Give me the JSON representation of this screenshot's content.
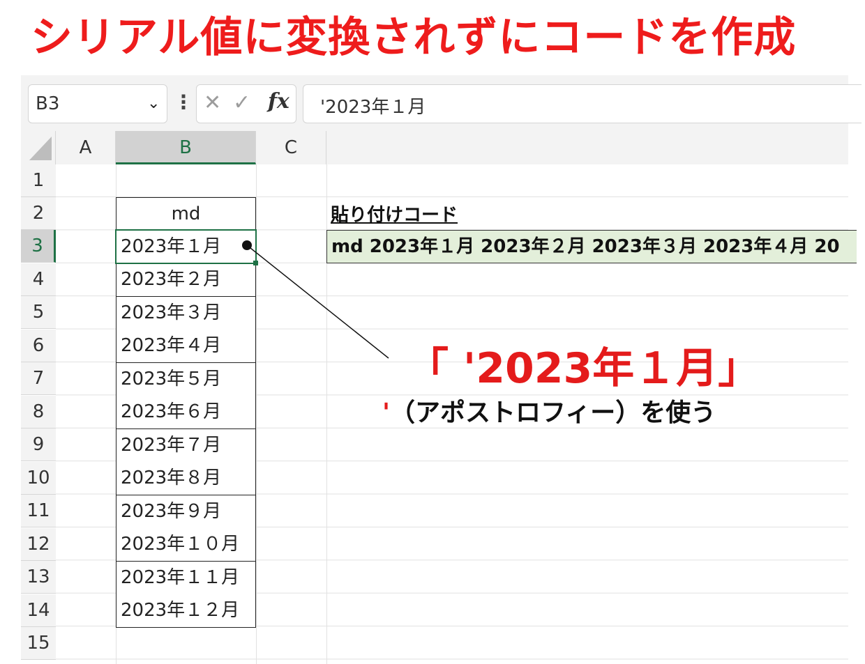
{
  "headline": "シリアル値に変換されずにコードを作成",
  "name_box": {
    "value": "B3"
  },
  "formula_bar": {
    "cancel_glyph": "✕",
    "enter_glyph": "✓",
    "fx_label": "fx",
    "value": "'2023年１月"
  },
  "columns": [
    "A",
    "B",
    "C"
  ],
  "rows": [
    "1",
    "2",
    "3",
    "4",
    "5",
    "6",
    "7",
    "8",
    "9",
    "10",
    "11",
    "12",
    "13",
    "14",
    "15"
  ],
  "column_b": {
    "header": "md",
    "values": [
      "2023年１月",
      "2023年２月",
      "2023年３月",
      "2023年４月",
      "2023年５月",
      "2023年６月",
      "2023年７月",
      "2023年８月",
      "2023年９月",
      "2023年１０月",
      "2023年１１月",
      "2023年１２月"
    ]
  },
  "paste_section": {
    "label": "貼り付けコード",
    "code": "md 2023年１月 2023年２月 2023年３月 2023年４月 20"
  },
  "callout": {
    "main": "「 '2023年１月」",
    "apostrophe": "'",
    "sub": "（アポストロフィー）を使う"
  },
  "colors": {
    "headline": "#ee1c1c",
    "accent_green": "#1e7145",
    "paste_fill": "#e3efda"
  }
}
